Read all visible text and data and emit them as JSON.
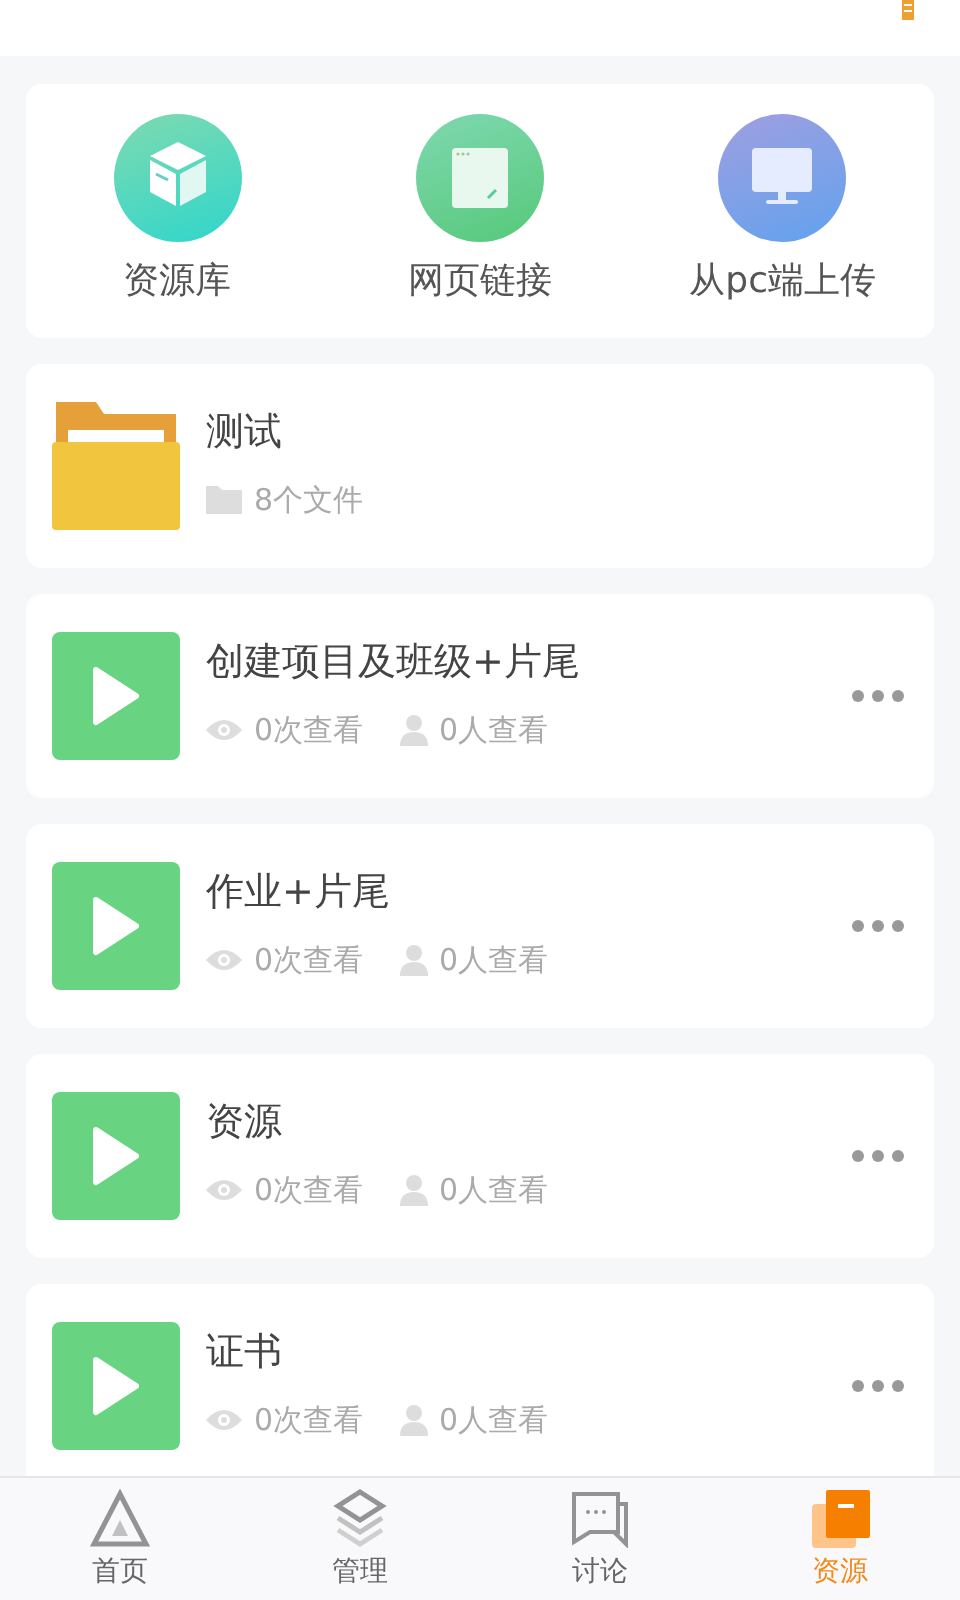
{
  "shortcuts": [
    {
      "kind": "library",
      "label": "资源库"
    },
    {
      "kind": "weblink",
      "label": "网页链接"
    },
    {
      "kind": "pc",
      "label": "从pc端上传"
    }
  ],
  "items": [
    {
      "kind": "folder",
      "title": "测试",
      "count": "8个文件"
    },
    {
      "kind": "video",
      "title": "创建项目及班级+片尾",
      "views": "0次查看",
      "viewers": "0人查看"
    },
    {
      "kind": "video",
      "title": "作业+片尾",
      "views": "0次查看",
      "viewers": "0人查看"
    },
    {
      "kind": "video",
      "title": "资源",
      "views": "0次查看",
      "viewers": "0人查看"
    },
    {
      "kind": "video",
      "title": "证书",
      "views": "0次查看",
      "viewers": "0人查看"
    }
  ],
  "tabs": [
    {
      "kind": "home",
      "label": "首页",
      "selected": false
    },
    {
      "kind": "manage",
      "label": "管理",
      "selected": false
    },
    {
      "kind": "discuss",
      "label": "讨论",
      "selected": false
    },
    {
      "kind": "resources",
      "label": "资源",
      "selected": true
    }
  ]
}
